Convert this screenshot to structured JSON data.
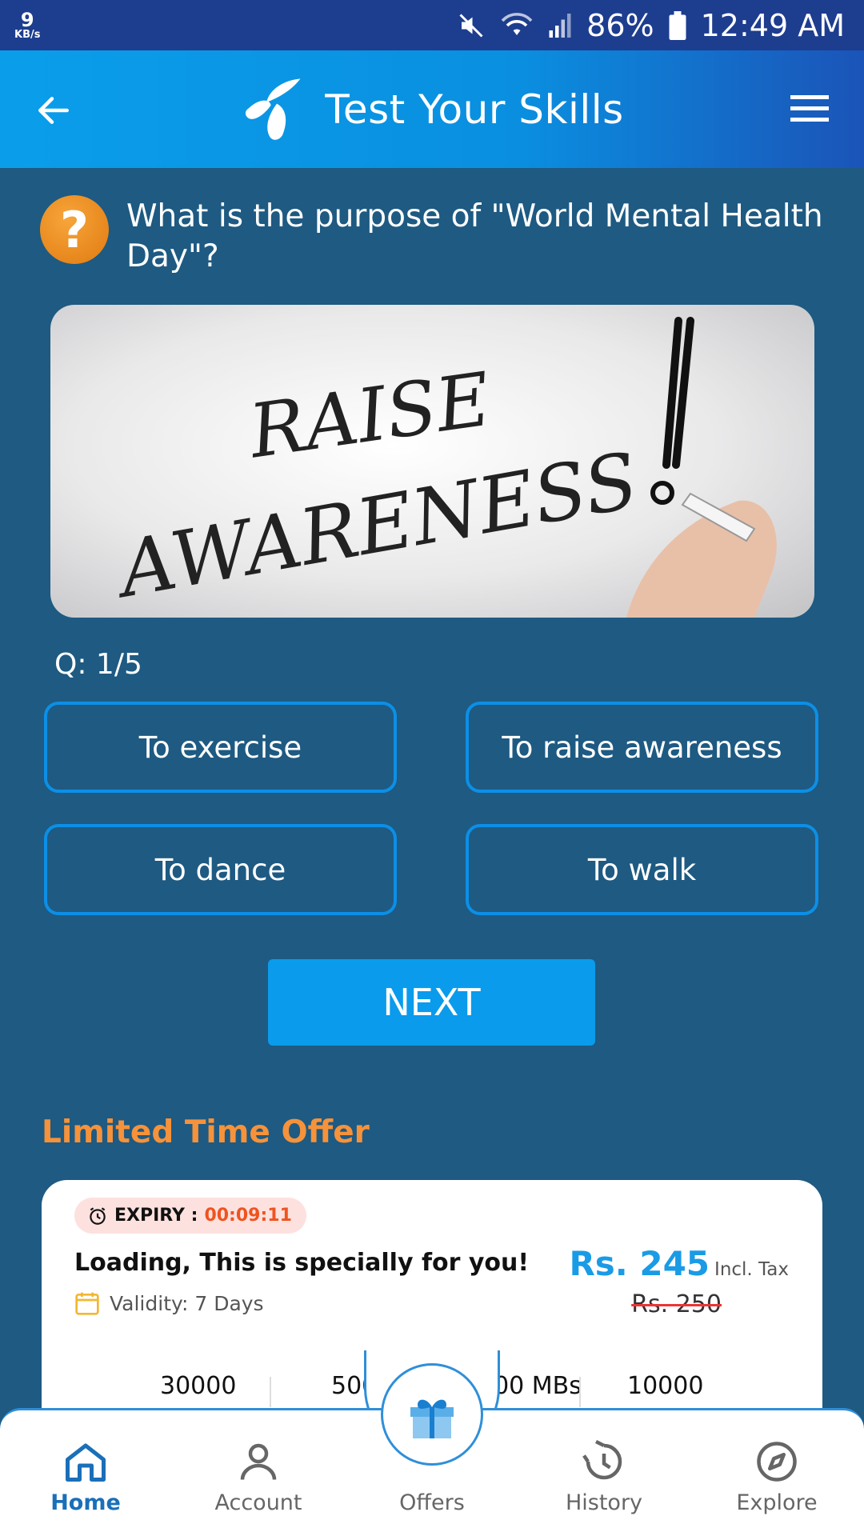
{
  "status_bar": {
    "net_speed_value": "9",
    "net_speed_unit": "KB/s",
    "battery_percent": "86%",
    "time": "12:49 AM"
  },
  "header": {
    "title": "Test Your Skills"
  },
  "quiz": {
    "question": "What is the purpose of \"World Mental Health Day\"?",
    "counter": "Q: 1/5",
    "image_text_line1": "RAISE",
    "image_text_line2": "AWARENESS",
    "options": [
      {
        "label": "To exercise"
      },
      {
        "label": "To raise awareness"
      },
      {
        "label": "To dance"
      },
      {
        "label": "To walk"
      }
    ],
    "next_label": "NEXT"
  },
  "offer": {
    "heading": "Limited Time Offer",
    "expiry_label": "EXPIRY :",
    "expiry_time": "00:09:11",
    "title": "Loading, This is specially for you!",
    "validity": "Validity: 7 Days",
    "price": "Rs. 245",
    "price_tax": "Incl. Tax",
    "price_old": "Rs. 250",
    "stats": [
      "30000",
      "500",
      "000 MBs",
      "10000"
    ]
  },
  "bottom_nav": {
    "items": [
      {
        "label": "Home",
        "icon": "home-icon",
        "active": true
      },
      {
        "label": "Account",
        "icon": "account-icon"
      },
      {
        "label": "Offers",
        "icon": "gift-icon"
      },
      {
        "label": "History",
        "icon": "history-icon"
      },
      {
        "label": "Explore",
        "icon": "compass-icon"
      }
    ]
  },
  "colors": {
    "background": "#1e5a82",
    "accent": "#0a9bec",
    "offer_orange": "#f6923a",
    "expiry_red": "#f0531f"
  }
}
